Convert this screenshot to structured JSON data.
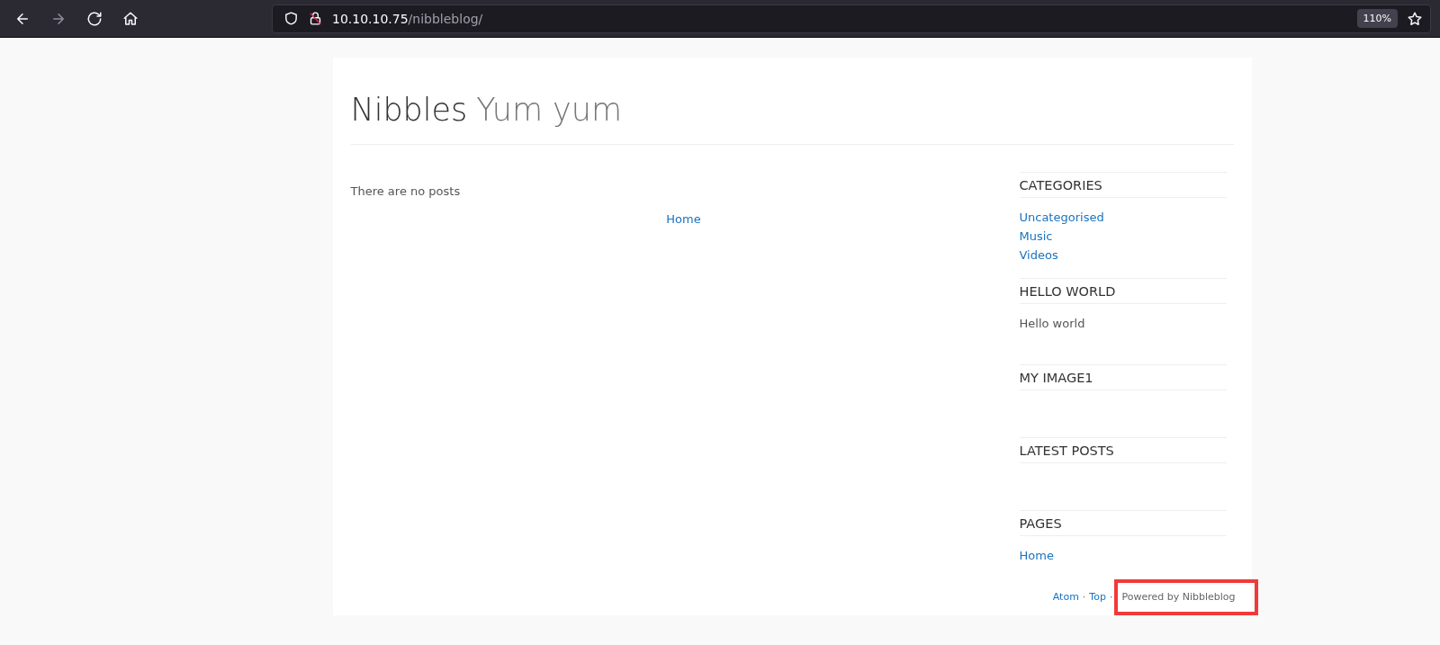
{
  "browser": {
    "url_host": "10.10.10.75",
    "url_path": "/nibbleblog/",
    "zoom": "110%"
  },
  "blog": {
    "title": "Nibbles",
    "slogan": "Yum yum"
  },
  "main": {
    "message": "There are no posts",
    "pager_link": "Home"
  },
  "sidebar": [
    {
      "kind": "links",
      "title": "CATEGORIES",
      "items": [
        "Uncategorised",
        "Music",
        "Videos"
      ]
    },
    {
      "kind": "text",
      "title": "HELLO WORLD",
      "text": "Hello world"
    },
    {
      "kind": "empty",
      "title": "MY IMAGE1"
    },
    {
      "kind": "empty",
      "title": "LATEST POSTS"
    },
    {
      "kind": "links",
      "title": "PAGES",
      "items": [
        "Home"
      ]
    }
  ],
  "footer": {
    "links": [
      "Atom",
      "Top"
    ],
    "separator": "·",
    "credit": "Powered by Nibbleblog"
  }
}
